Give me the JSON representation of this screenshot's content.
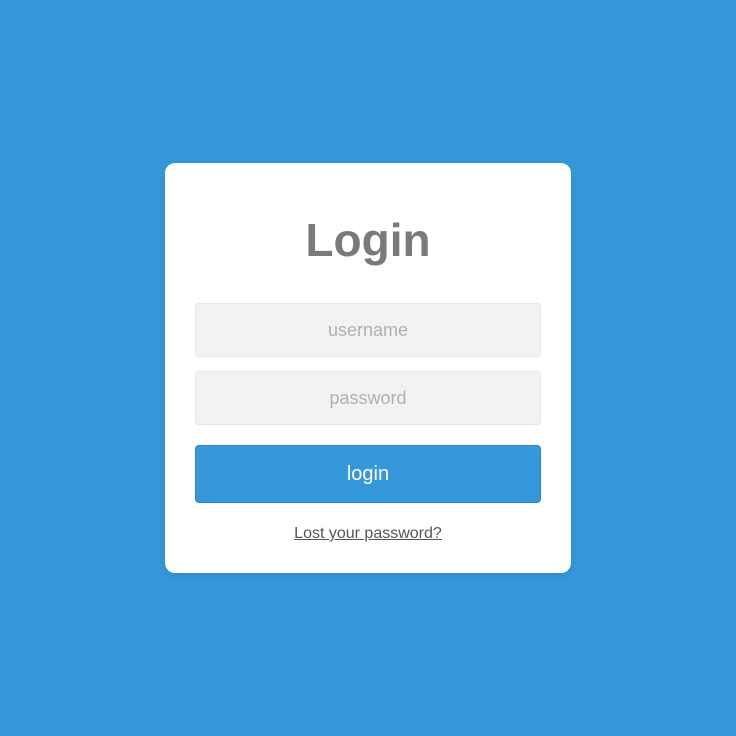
{
  "login": {
    "title": "Login",
    "username_placeholder": "username",
    "password_placeholder": "password",
    "button_label": "login",
    "lost_password_label": "Lost your password?"
  }
}
